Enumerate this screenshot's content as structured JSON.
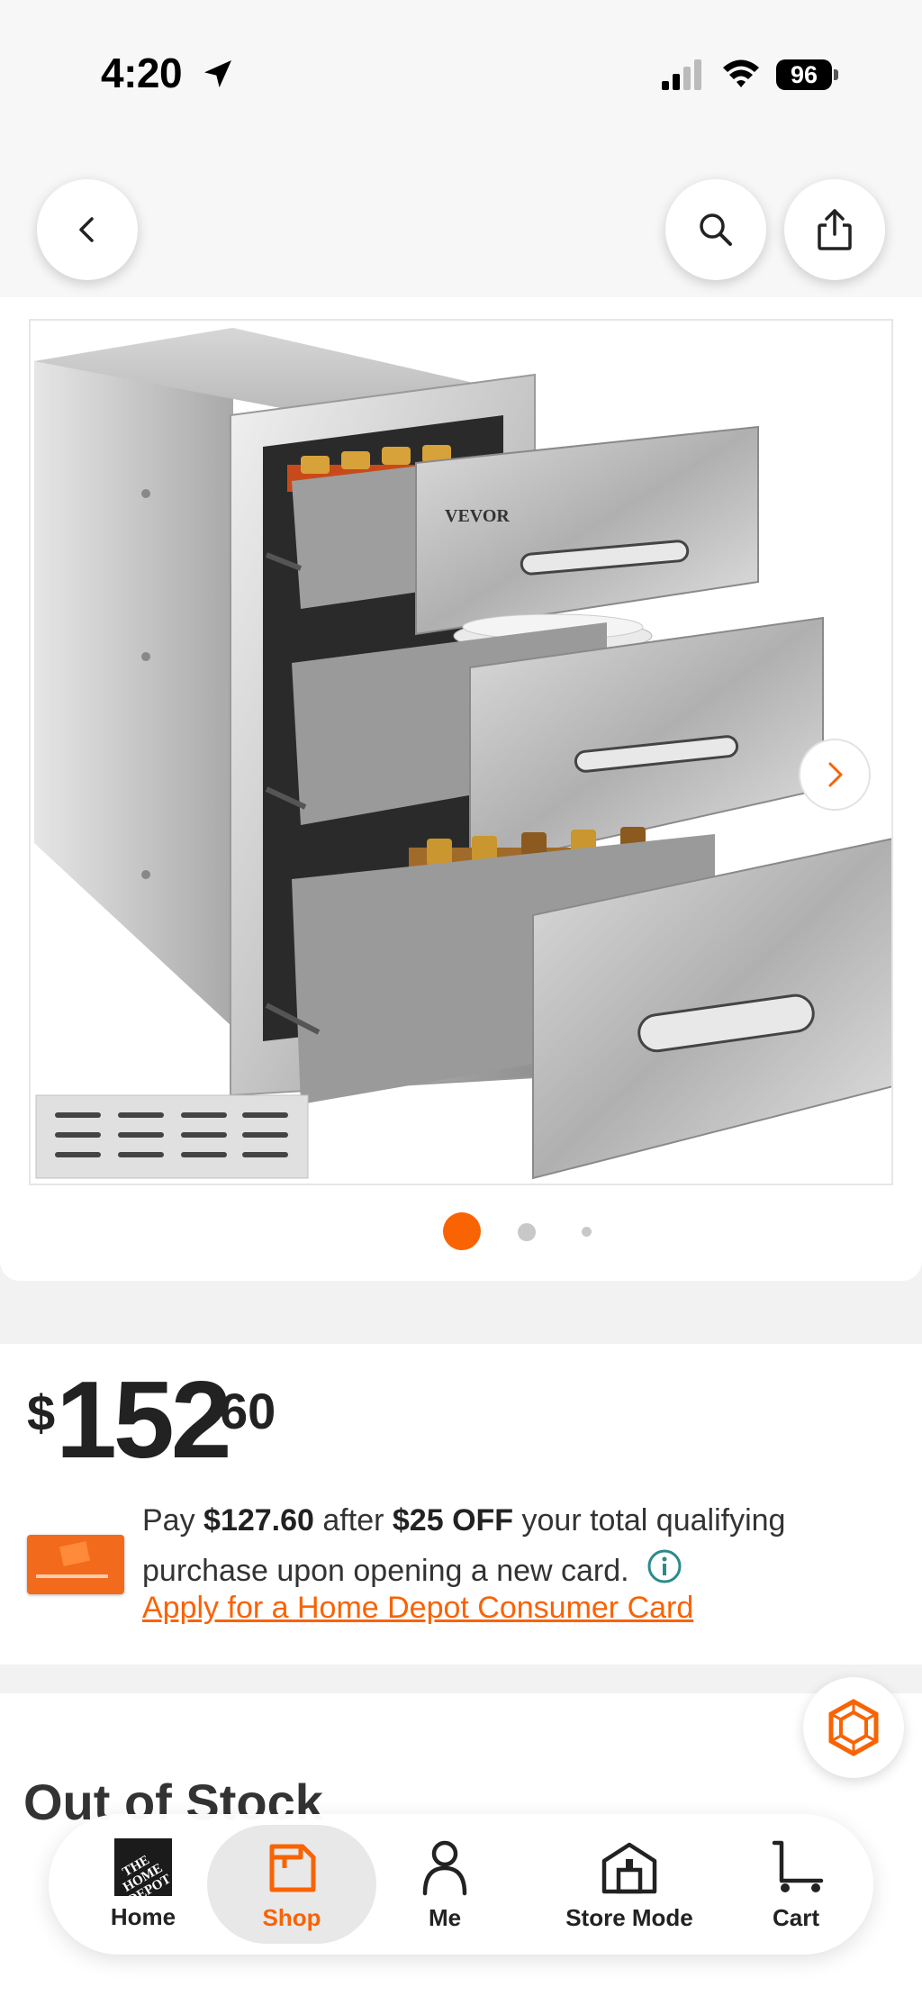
{
  "status_bar": {
    "time": "4:20",
    "battery": "96"
  },
  "colors": {
    "accent": "#f96302",
    "background": "#f2f2f2",
    "text": "#222222"
  },
  "header": {
    "icons": [
      "chevron-left-icon",
      "search-icon",
      "share-icon"
    ]
  },
  "product": {
    "brand_on_image": "VEVOR",
    "carousel": {
      "total_images": 3,
      "active_index": 0
    }
  },
  "price": {
    "dollar_sign": "$",
    "whole": "152",
    "cents": "60"
  },
  "offer": {
    "pay_prefix": "Pay ",
    "pay_amount": "$127.60",
    "after": " after ",
    "discount": "$25 OFF",
    "rest": " your total qualifying purchase upon opening a new card.",
    "apply_link": "Apply for a Home Depot Consumer Card"
  },
  "stock": {
    "status": "Out of Stock"
  },
  "bottom_nav": {
    "items": [
      {
        "label": "Home",
        "icon": "home-depot-logo-icon"
      },
      {
        "label": "Shop",
        "icon": "shop-icon",
        "active": true
      },
      {
        "label": "Me",
        "icon": "person-icon"
      },
      {
        "label": "Store Mode",
        "icon": "store-icon"
      },
      {
        "label": "Cart",
        "icon": "cart-icon"
      }
    ],
    "logo_text": "THE HOME DEPOT"
  }
}
